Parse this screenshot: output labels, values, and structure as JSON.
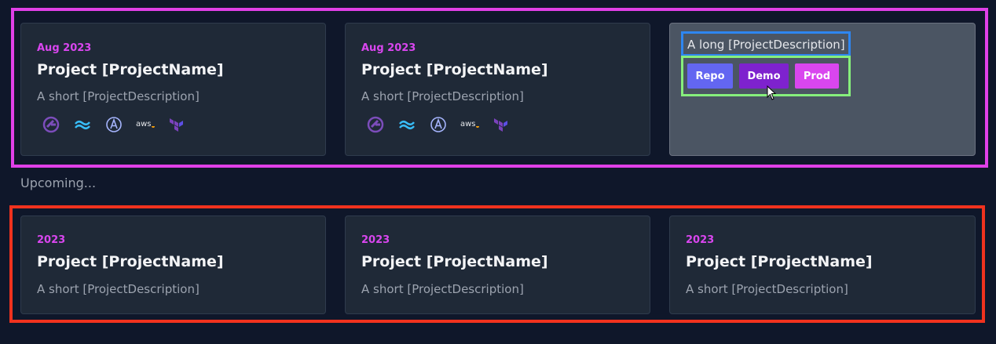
{
  "current_projects": [
    {
      "date": "Aug 2023",
      "title": "Project [ProjectName]",
      "description": "A short [ProjectDescription]",
      "tech_icons": [
        "gatsby-icon",
        "tailwind-icon",
        "apollo-icon",
        "aws-icon",
        "terraform-icon"
      ]
    },
    {
      "date": "Aug 2023",
      "title": "Project [ProjectName]",
      "description": "A short [ProjectDescription]",
      "tech_icons": [
        "gatsby-icon",
        "tailwind-icon",
        "apollo-icon",
        "aws-icon",
        "terraform-icon"
      ]
    }
  ],
  "hover_card": {
    "long_description": "A long [ProjectDescription]",
    "buttons": {
      "repo": "Repo",
      "demo": "Demo",
      "prod": "Prod"
    }
  },
  "aws_label": "aws",
  "upcoming_label": "Upcoming...",
  "upcoming_projects": [
    {
      "date": "2023",
      "title": "Project [ProjectName]",
      "description": "A short [ProjectDescription]"
    },
    {
      "date": "2023",
      "title": "Project [ProjectName]",
      "description": "A short [ProjectDescription]"
    },
    {
      "date": "2023",
      "title": "Project [ProjectName]",
      "description": "A short [ProjectDescription]"
    }
  ],
  "colors": {
    "background": "#0f172a",
    "card": "#1f2937",
    "accent": "#d946ef",
    "top_frame": "#e040e8",
    "bottom_frame": "#f0321e",
    "desc_frame": "#2e86f0",
    "buttons_frame": "#86ef7c"
  }
}
